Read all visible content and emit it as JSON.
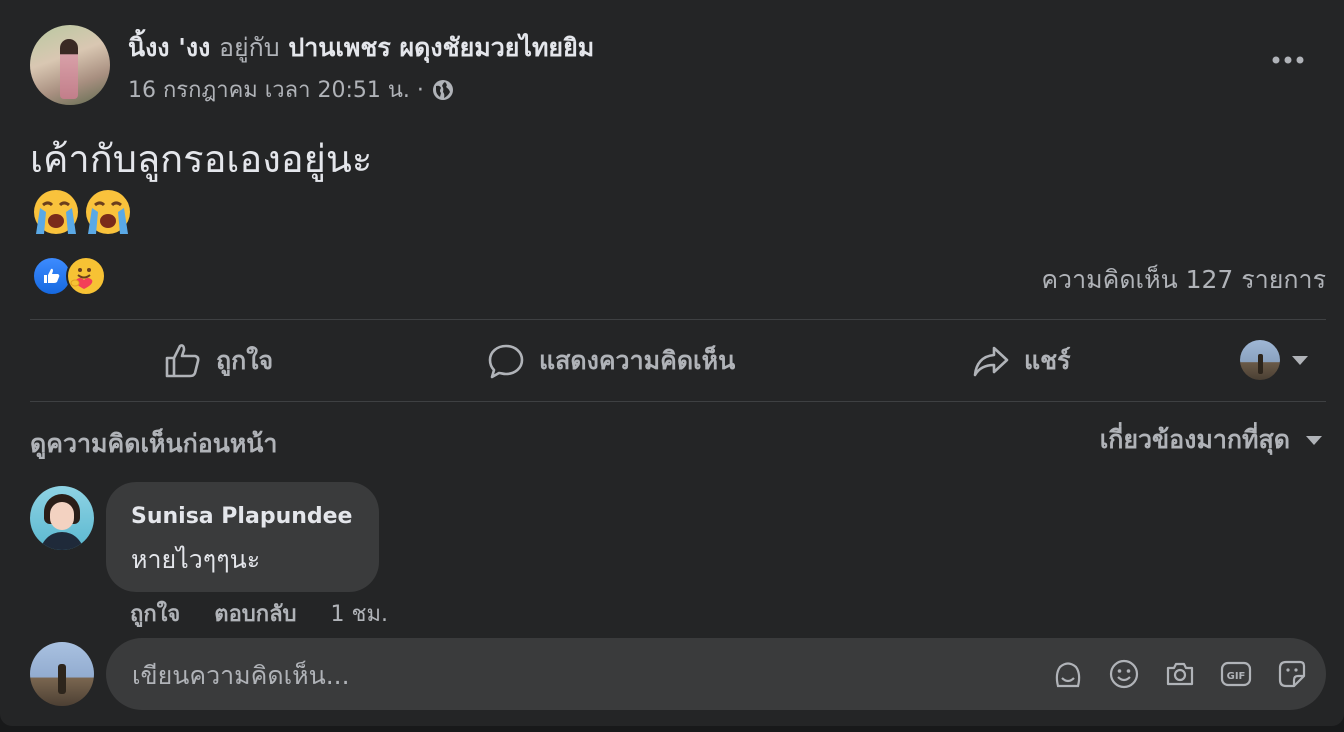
{
  "post": {
    "author": "นิ้งง 'งง",
    "with_word": "อยู่กับ",
    "tagged": "ปานเพชร ผดุงชัยมวยไทยยิม",
    "timestamp": "16 กรกฎาคม เวลา 20:51 น. ·",
    "privacy_icon": "globe-icon",
    "text": "เค้ากับลูกรอเองอยู่นะ",
    "emojis": "😭😭",
    "reactions": [
      "like",
      "care"
    ],
    "comment_count": "ความคิดเห็น 127 รายการ"
  },
  "actions": {
    "like": "ถูกใจ",
    "comment": "แสดงความคิดเห็น",
    "share": "แชร์"
  },
  "comments_section": {
    "view_previous": "ดูความคิดเห็นก่อนหน้า",
    "sort_label": "เกี่ยวข้องมากที่สุด"
  },
  "comments": [
    {
      "name": "Sunisa Plapundee",
      "text": "หายไวๆๆนะ",
      "like": "ถูกใจ",
      "reply": "ตอบกลับ",
      "time": "1 ชม."
    }
  ],
  "composer": {
    "placeholder": "เขียนความคิดเห็น..."
  },
  "colors": {
    "card_bg": "#242526",
    "bubble_bg": "#3a3b3c",
    "primary_text": "#e4e6eb",
    "secondary_text": "#b0b3b8",
    "like_blue": "#1877f2"
  }
}
